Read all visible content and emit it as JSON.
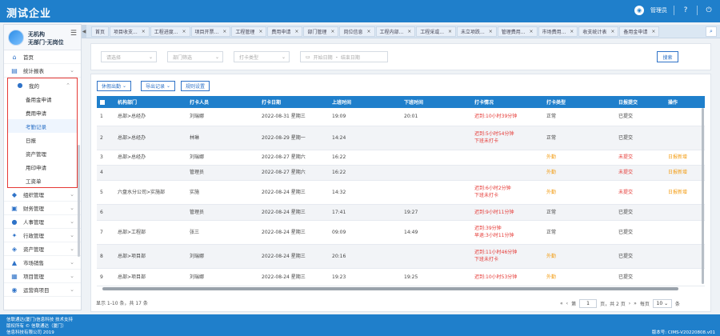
{
  "header": {
    "app_title": "测试企业",
    "user_label": "管理员",
    "help_icon": "?"
  },
  "sidebar": {
    "org_name": "无机构",
    "org_sub": "无部门·无岗位",
    "top_items": [
      {
        "label": "首页",
        "icon": "home-icon"
      },
      {
        "label": "统计报表",
        "icon": "chart-icon"
      }
    ],
    "group": {
      "label": "我的",
      "icon": "user-icon"
    },
    "sub_items": [
      {
        "label": "备用金申请",
        "active": false
      },
      {
        "label": "费用申请",
        "active": false
      },
      {
        "label": "考勤记录",
        "active": true
      },
      {
        "label": "日报",
        "active": false
      },
      {
        "label": "资产管理",
        "active": false
      },
      {
        "label": "用印申请",
        "active": false
      },
      {
        "label": "工资单",
        "active": false
      }
    ],
    "bottom_items": [
      {
        "label": "组织管理",
        "icon": "org-icon"
      },
      {
        "label": "财务管理",
        "icon": "finance-icon"
      },
      {
        "label": "人事管理",
        "icon": "hr-icon"
      },
      {
        "label": "行政管理",
        "icon": "admin-icon"
      },
      {
        "label": "资产管理",
        "icon": "asset-icon"
      },
      {
        "label": "市场销售",
        "icon": "market-icon"
      },
      {
        "label": "项目管理",
        "icon": "project-icon"
      },
      {
        "label": "运营商项目",
        "icon": "operator-icon"
      }
    ]
  },
  "tabs": [
    "首页",
    "项目收支...",
    "工程进度...",
    "项目开票...",
    "工程管理",
    "费用申请",
    "部门管理",
    "岗位信息",
    "工程内部...",
    "工程采或...",
    "未立项跌...",
    "管理费用...",
    "市场费用...",
    "收支统计表",
    "备用金申请"
  ],
  "filters": {
    "org_placeholder": "请选择",
    "dept_placeholder": "部门筛选",
    "type_placeholder": "打卡类型",
    "start_placeholder": "开始日期",
    "date_sep": "-",
    "end_placeholder": "结束日期",
    "search_label": "搜索"
  },
  "toolbar": {
    "export_leave": "休假出勤",
    "export_records": "导出记录",
    "settings": "规则设置"
  },
  "table": {
    "headers": [
      "机构部门",
      "打卡人员",
      "打卡日期",
      "上班时间",
      "下班时间",
      "打卡情况",
      "打卡类型",
      "日报提交",
      "操作"
    ],
    "rows": [
      {
        "no": "1",
        "dept": "总部>总经办",
        "person": "刘瑞娜",
        "date": "2022-08-31 星期三",
        "in": "19:09",
        "out": "20:01",
        "status": [
          "迟到:10小时39分钟"
        ],
        "type": "正常",
        "report": "已提交",
        "op": ""
      },
      {
        "no": "2",
        "dept": "总部>总经办",
        "person": "林琳",
        "date": "2022-08-29 星期一",
        "in": "14:24",
        "out": "",
        "status": [
          "迟到:5小时54分钟",
          "下班未打卡"
        ],
        "type": "正常",
        "report": "已提交",
        "op": ""
      },
      {
        "no": "3",
        "dept": "总部>总经办",
        "person": "刘瑞娜",
        "date": "2022-08-27 星期六",
        "in": "16:22",
        "out": "",
        "status": [],
        "type": "外勤",
        "report": "未提交",
        "op": "日报新增"
      },
      {
        "no": "4",
        "dept": "",
        "person": "管理员",
        "date": "2022-08-27 星期六",
        "in": "16:22",
        "out": "",
        "status": [],
        "type": "外勤",
        "report": "未提交",
        "op": "日报新增"
      },
      {
        "no": "5",
        "dept": "六盘水分公司>实施部",
        "person": "实施",
        "date": "2022-08-24 星期三",
        "in": "14:32",
        "out": "",
        "status": [
          "迟到:6小时2分钟",
          "下班未打卡"
        ],
        "type": "外勤",
        "report": "未提交",
        "op": "日报新增"
      },
      {
        "no": "6",
        "dept": "",
        "person": "管理员",
        "date": "2022-08-24 星期三",
        "in": "17:41",
        "out": "19:27",
        "status": [
          "迟到:9小时11分钟"
        ],
        "type": "正常",
        "report": "已提交",
        "op": ""
      },
      {
        "no": "7",
        "dept": "总部>工程部",
        "person": "张三",
        "date": "2022-08-24 星期三",
        "in": "09:09",
        "out": "14:49",
        "status": [
          "迟到:39分钟",
          "早退:3小时11分钟"
        ],
        "type": "正常",
        "report": "已提交",
        "op": ""
      },
      {
        "no": "8",
        "dept": "总部>项目部",
        "person": "刘瑞娜",
        "date": "2022-08-24 星期三",
        "in": "20:16",
        "out": "",
        "status": [
          "迟到:11小时46分钟",
          "下班未打卡"
        ],
        "type": "外勤",
        "report": "已提交",
        "op": ""
      },
      {
        "no": "9",
        "dept": "总部>项目部",
        "person": "刘瑞娜",
        "date": "2022-08-24 星期三",
        "in": "19:23",
        "out": "19:25",
        "status": [
          "迟到:10小时53分钟"
        ],
        "type": "外勤",
        "report": "已提交",
        "op": ""
      }
    ]
  },
  "footer": {
    "count": "显示 1-10 条，共 17 条",
    "page_prefix": "第",
    "page_value": "1",
    "page_suffix": "页，共 2 页",
    "per_page_label": "每页",
    "per_page_value": "10",
    "per_page_unit": "条"
  },
  "bottombar": {
    "line1": "信联通达(厦门)信息科技 技术支持",
    "line2": "版权所有 © 信联通达（厦门）",
    "line3": "信息科技有限公司 2019",
    "version": "版本号: CIMS-V20220808.v01"
  }
}
